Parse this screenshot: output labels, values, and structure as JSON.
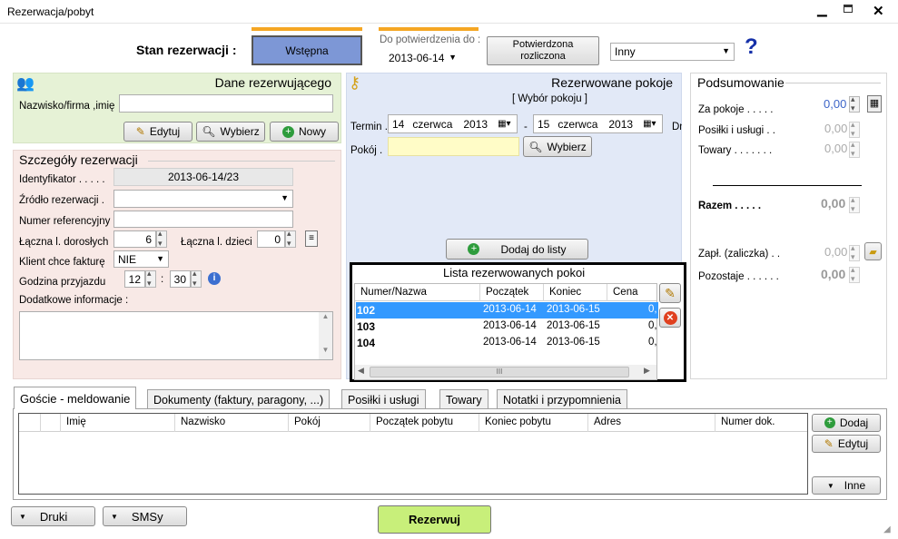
{
  "window": {
    "title": "Rezerwacja/pobyt"
  },
  "status_bar": {
    "label": "Stan rezerwacji :",
    "wstepna": "Wstępna",
    "confirm_label": "Do potwierdzenia do :",
    "confirm_date": "2013-06-14",
    "confirmed_line1": "Potwierdzona",
    "confirmed_line2": "rozliczona",
    "other": "Inny",
    "help": "?"
  },
  "booker": {
    "title": "Dane rezerwującego",
    "name_label": "Nazwisko/firma ,imię",
    "name_value": "",
    "edit": "Edytuj",
    "select": "Wybierz",
    "new": "Nowy"
  },
  "details": {
    "title": "Szczegóły rezerwacji",
    "id_label": "Identyfikator . . . . .",
    "id_value": "2013-06-14/23",
    "source_label": "Źródło rezerwacji .",
    "source_value": "",
    "ref_label": "Numer referencyjny",
    "ref_value": "",
    "adults_label": "Łączna l. dorosłych",
    "adults_value": "6",
    "children_label": "Łączna l. dzieci",
    "children_value": "0",
    "invoice_label": "Klient chce fakturę",
    "invoice_value": "NIE",
    "arrival_label": "Godzina przyjazdu",
    "arrival_hour": "12",
    "arrival_sep": ":",
    "arrival_min": "30",
    "info_label": "Dodatkowe informacje :",
    "info_value": ""
  },
  "rooms": {
    "title": "Rezerwowane pokoje",
    "choose": "[ Wybór pokoju ]",
    "term_label": "Termin .",
    "from_day": "14",
    "from_month": "czerwca",
    "from_year": "2013",
    "dash": "-",
    "to_day": "15",
    "to_month": "czerwca",
    "to_year": "2013",
    "cut_label": "Dni",
    "room_label": "Pokój .",
    "room_value": "",
    "select": "Wybierz",
    "add": "Dodaj do listy",
    "list_title": "Lista rezerwowanych pokoi",
    "columns": [
      "Numer/Nazwa",
      "Początek",
      "Koniec",
      "Cena"
    ],
    "rows": [
      {
        "num": "102",
        "start": "2013-06-14",
        "end": "2013-06-15",
        "price": "0,",
        "selected": true
      },
      {
        "num": "103",
        "start": "2013-06-14",
        "end": "2013-06-15",
        "price": "0,",
        "selected": false
      },
      {
        "num": "104",
        "start": "2013-06-14",
        "end": "2013-06-15",
        "price": "0,",
        "selected": false
      }
    ],
    "scroll_grip": "III"
  },
  "summary": {
    "title": "Podsumowanie",
    "rooms_label": "Za pokoje . . . . .",
    "rooms_value": "0,00",
    "meals_label": "Posiłki i usługi . .",
    "meals_value": "0,00",
    "goods_label": "Towary . . . . . . .",
    "goods_value": "0,00",
    "total_label": "Razem . . . . .",
    "total_value": "0,00",
    "paid_label": "Zapł. (zaliczka) . .",
    "paid_value": "0,00",
    "left_label": "Pozostaje . . . . . .",
    "left_value": "0,00"
  },
  "tabs": [
    "Goście - meldowanie",
    "Dokumenty (faktury, paragony, ...)",
    "Posiłki i usługi",
    "Towary",
    "Notatki i przypomnienia"
  ],
  "guests": {
    "columns": [
      "Imię",
      "Nazwisko",
      "Pokój",
      "Początek pobytu",
      "Koniec pobytu",
      "Adres",
      "Numer dok."
    ],
    "add": "Dodaj",
    "edit": "Edytuj",
    "other": "Inne"
  },
  "footer": {
    "prints": "Druki",
    "sms": "SMSy",
    "reserve": "Rezerwuj"
  },
  "colors": {
    "green_panel": "#e6f2d6",
    "pink_panel": "#f8e9e6",
    "blue_panel": "#e2e9f7",
    "selected_row": "#3399ff",
    "reserve_btn": "#c8ef7a",
    "accent_orange": "#f5a623"
  }
}
